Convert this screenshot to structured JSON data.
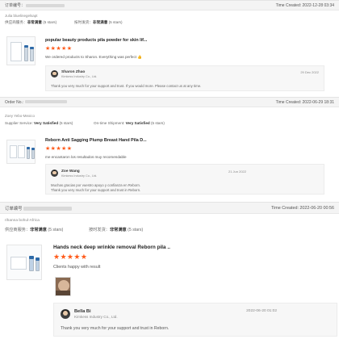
{
  "colors": {
    "star": "#ff5a1a",
    "header_bg": "#f4f4f4",
    "reply_bg": "#f7f7f7"
  },
  "orders": [
    {
      "order_label": "订单编号：",
      "time_created": "Time Created: 2022-12-28 03:34",
      "buyer": "Julia bluelinegelsapt",
      "supplier_service_label": "供应商服务：",
      "supplier_service_value": "非常满意",
      "supplier_service_stars": "(5 stars)",
      "shipment_label": "按时发货：",
      "shipment_value": "非常满意",
      "shipment_stars": "(5 stars)",
      "product_title": "popular beauty products pila powder for skin lif...",
      "rating": "★★★★★",
      "review": "We ordered products to Sharon. Everything was perfect 👍",
      "reply_name": "Sharon Zhao",
      "reply_company": "Kimkess Industry Co., Ltd.",
      "reply_date": "29 Dec 2022",
      "reply_text": "Thank you very much for your support and trust. If you would more. Please contact us at any time."
    },
    {
      "order_label": "Order No.:",
      "time_created": "Time Created: 2022-06-29 18:31",
      "buyer": "Zoey Yebo-Mexico",
      "supplier_service_label": "Supplier Service:",
      "supplier_service_value": "Very Satisfied",
      "supplier_service_stars": "(5 stars)",
      "shipment_label": "On-time Shipment:",
      "shipment_value": "Very Satisfied",
      "shipment_stars": "(5 stars)",
      "product_title": "Reborn Anti Sagging Plump Breast Hand Pila D...",
      "rating": "★★★★★",
      "review": "me encantaron los resultados muy recomendable",
      "reply_name": "Zoe Wang",
      "reply_company": "Kimkess Industry Co., Ltd.",
      "reply_date": "21 Jun 2022",
      "reply_text_1": "Muchas gracias por vuestro apoyo y confianza en Reborn.",
      "reply_text_2": "Thank you very much for your support and trust in Reborn."
    },
    {
      "order_label": "订单编号",
      "time_created": "Time Created: 2022-06-20 00:56",
      "buyer": "rihanna bohul-Africa",
      "supplier_service_label": "供应商服务：",
      "supplier_service_value": "非常满意",
      "supplier_service_stars": "(5 stars)",
      "shipment_label": "按时发货：",
      "shipment_value": "非常满意",
      "shipment_stars": "(5 stars)",
      "product_title": "Hands neck deep wrinkle removal Reborn pila ..",
      "rating": "★★★★★",
      "review": "Clients happy with result",
      "reply_name": "Bella Bi",
      "reply_company": "Kimkess Industry Co., Ltd.",
      "reply_date": "2022-06-20 01:02",
      "reply_text": "Thank you very much for your support and trust in Reborn."
    }
  ]
}
